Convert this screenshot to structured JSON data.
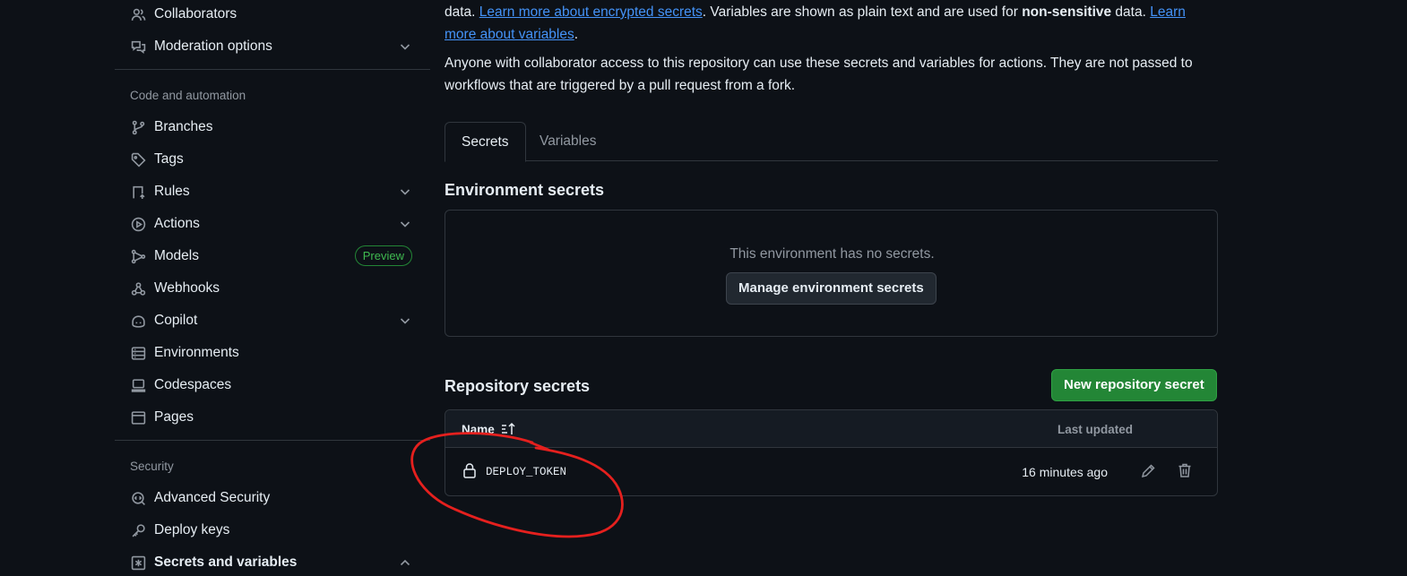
{
  "sidebar": {
    "items": [
      {
        "label": "Collaborators"
      },
      {
        "label": "Moderation options"
      },
      {
        "label": "Branches"
      },
      {
        "label": "Tags"
      },
      {
        "label": "Rules"
      },
      {
        "label": "Actions"
      },
      {
        "label": "Models",
        "badge": "Preview"
      },
      {
        "label": "Webhooks"
      },
      {
        "label": "Copilot"
      },
      {
        "label": "Environments"
      },
      {
        "label": "Codespaces"
      },
      {
        "label": "Pages"
      },
      {
        "label": "Advanced Security"
      },
      {
        "label": "Deploy keys"
      },
      {
        "label": "Secrets and variables"
      }
    ],
    "sections": {
      "code_automation": "Code and automation",
      "security": "Security"
    }
  },
  "intro": {
    "line1_a": "data. ",
    "link1": "Learn more about encrypted secrets",
    "line1_b": ". Variables are shown as plain text and are used for ",
    "bold": "non-sensitive",
    "line1_c": " data. ",
    "link2": "Learn more about variables",
    "line1_d": ".",
    "para2": "Anyone with collaborator access to this repository can use these secrets and variables for actions. They are not passed to workflows that are triggered by a pull request from a fork."
  },
  "tabs": {
    "secrets": "Secrets",
    "variables": "Variables"
  },
  "env_secrets": {
    "title": "Environment secrets",
    "empty": "This environment has no secrets.",
    "manage_button": "Manage environment secrets"
  },
  "repo_secrets": {
    "title": "Repository secrets",
    "new_button": "New repository secret",
    "col_name": "Name",
    "col_updated": "Last updated",
    "rows": [
      {
        "name": "DEPLOY_TOKEN",
        "updated": "16 minutes ago"
      }
    ]
  },
  "colors": {
    "accent": "#4493f8",
    "success": "#238636",
    "annotation": "#e5201e"
  }
}
